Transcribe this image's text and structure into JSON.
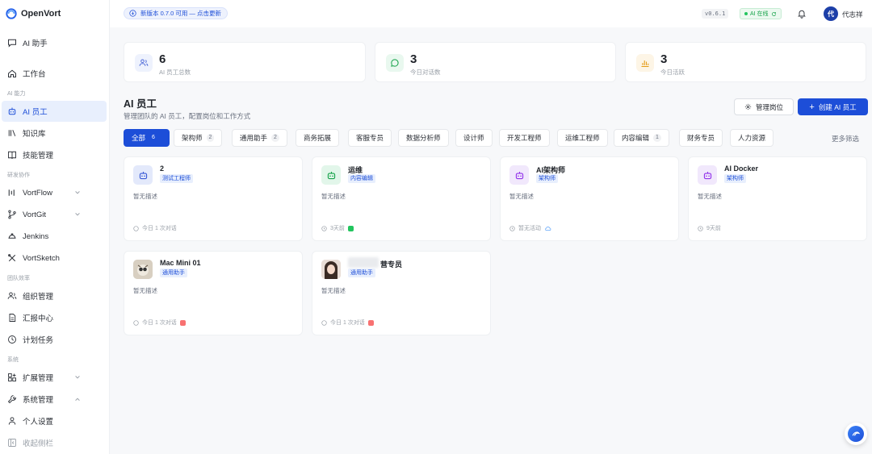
{
  "app": {
    "name": "OpenVort"
  },
  "topbar": {
    "update_text": "新版本 0.7.0 可用 — 点击更新",
    "version": "v0.6.1",
    "ai_status": "AI 在线",
    "user_initial": "代",
    "user_name": "代志祥"
  },
  "sidebar": {
    "ai_assistant": "AI 助手",
    "workbench": "工作台",
    "section_ai": "AI 能力",
    "ai_employee": "AI 员工",
    "knowledge": "知识库",
    "skills": "技能管理",
    "section_dev": "研发协作",
    "vortflow": "VortFlow",
    "vortgit": "VortGit",
    "jenkins": "Jenkins",
    "vortsketch": "VortSketch",
    "section_team": "团队效率",
    "org": "组织管理",
    "report": "汇报中心",
    "schedule": "计划任务",
    "section_sys": "系统",
    "ext": "扩展管理",
    "sysmgmt": "系统管理",
    "profile": "个人设置",
    "collapse": "收起侧栏"
  },
  "stats": [
    {
      "value": "6",
      "label": "AI 员工总数",
      "color": "#4f6bd8",
      "bg": "#eef2fd"
    },
    {
      "value": "3",
      "label": "今日对话数",
      "color": "#16a34a",
      "bg": "#e9f8ef"
    },
    {
      "value": "3",
      "label": "今日活跃",
      "color": "#e49b14",
      "bg": "#fdf5e6"
    }
  ],
  "section": {
    "title": "AI 员工",
    "subtitle": "管理团队的 AI 员工，配置岗位和工作方式",
    "manage_label": "管理岗位",
    "create_label": "创建 AI 员工"
  },
  "filters": [
    {
      "label": "全部",
      "count": "6"
    },
    {
      "label": "架构师",
      "count": "2"
    },
    {
      "label": "通用助手",
      "count": "2"
    },
    {
      "label": "商务拓展",
      "count": ""
    },
    {
      "label": "客服专员",
      "count": ""
    },
    {
      "label": "数据分析师",
      "count": ""
    },
    {
      "label": "设计师",
      "count": ""
    },
    {
      "label": "开发工程师",
      "count": ""
    },
    {
      "label": "运维工程师",
      "count": ""
    },
    {
      "label": "内容编辑",
      "count": "1"
    },
    {
      "label": "财务专员",
      "count": ""
    },
    {
      "label": "人力资源",
      "count": ""
    }
  ],
  "more_filter": "更多筛选",
  "cards": [
    {
      "name": "2",
      "tag": "测试工程师",
      "desc": "暂无描述",
      "meta": "今日 1 次对话"
    },
    {
      "name": "运维",
      "tag": "内容编辑",
      "desc": "暂无描述",
      "meta": "3天前"
    },
    {
      "name": "AI架构师",
      "tag": "架构师",
      "desc": "暂无描述",
      "meta": "暂无活动"
    },
    {
      "name": "AI Docker",
      "tag": "架构师",
      "desc": "暂无描述",
      "meta": "9天前"
    },
    {
      "name": "Mac Mini 01",
      "tag": "通用助手",
      "desc": "暂无描述",
      "meta": "今日 1 次对话"
    },
    {
      "name": "营专员",
      "tag": "通用助手",
      "desc": "暂无描述",
      "meta": "今日 1 次对话"
    }
  ]
}
